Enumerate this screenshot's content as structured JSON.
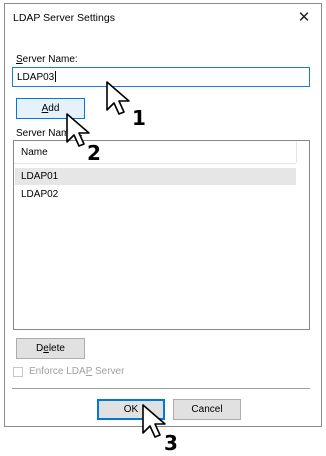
{
  "window": {
    "title": "LDAP Server Settings",
    "close_glyph": "✕"
  },
  "server_name": {
    "label_ul": "S",
    "label_rest": "erver Name:",
    "value": "LDAP03"
  },
  "add_button": {
    "pre": "",
    "ul": "A",
    "post": "dd"
  },
  "server_names_list": {
    "label": "Server Names:",
    "column_header": "Name",
    "items": [
      "LDAP01",
      "LDAP02"
    ],
    "selected_index": 0
  },
  "delete_button": {
    "pre": "D",
    "ul": "e",
    "post": "lete"
  },
  "enforce": {
    "pre": "Enforce LDA",
    "ul": "P",
    "post": " Server",
    "checked": false,
    "enabled": false
  },
  "ok_label": "OK",
  "cancel_label": "Cancel",
  "step_markers": [
    "1",
    "2",
    "3"
  ],
  "icons": [
    "close-icon",
    "mouse-pointer-icon"
  ],
  "colors": {
    "focus_blue": "#0078d7",
    "selection_gray": "#e6e6e6",
    "disabled_text": "#a0a0a0"
  }
}
